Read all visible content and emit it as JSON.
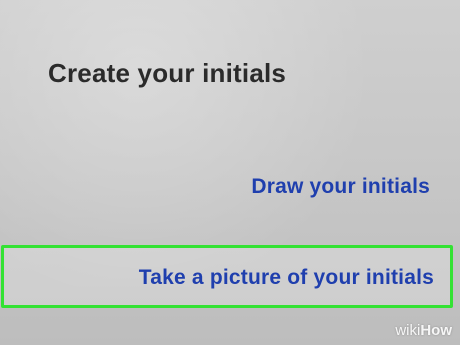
{
  "header": {
    "title": "Create your initials"
  },
  "options": {
    "draw_label": "Draw your initials",
    "picture_label": "Take a picture of your initials"
  },
  "colors": {
    "option_text": "#1f3fae",
    "highlight_border": "#33e233",
    "background": "#c9c9c9",
    "title_text": "#2b2b2b"
  },
  "watermark": {
    "part1": "wiki",
    "part2": "How"
  }
}
